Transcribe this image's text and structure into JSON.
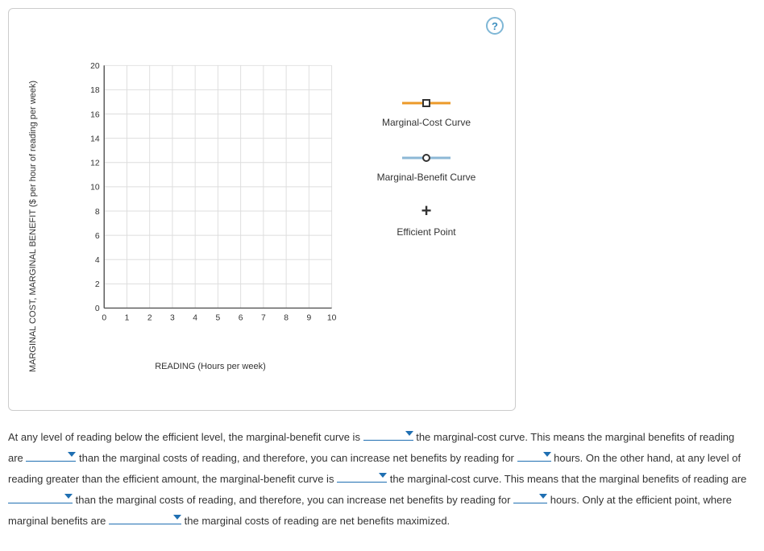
{
  "help_label": "?",
  "chart_data": {
    "type": "scatter",
    "title": "",
    "xlabel": "READING (Hours per week)",
    "ylabel": "MARGINAL COST, MARGINAL BENEFIT ($ per hour of reading per week)",
    "xlim": [
      0,
      10
    ],
    "ylim": [
      0,
      20
    ],
    "xticks": [
      0,
      1,
      2,
      3,
      4,
      5,
      6,
      7,
      8,
      9,
      10
    ],
    "yticks": [
      0,
      2,
      4,
      6,
      8,
      10,
      12,
      14,
      16,
      18,
      20
    ],
    "series": [],
    "legend": [
      {
        "name": "Marginal-Cost Curve",
        "style": "orange-square"
      },
      {
        "name": "Marginal-Benefit Curve",
        "style": "blue-circle"
      },
      {
        "name": "Efficient Point",
        "style": "black-plus"
      }
    ]
  },
  "paragraph": {
    "s1": "At any level of reading below the efficient level, the marginal-benefit curve is",
    "s2": "the marginal-cost curve. This means the marginal benefits of reading are",
    "s3": "than the marginal costs of reading, and therefore, you can increase net benefits by reading for",
    "s4": "hours. On the other hand, at any level of reading greater than the efficient amount, the marginal-benefit curve is",
    "s5": "the marginal-cost curve. This means that the marginal benefits of reading are",
    "s6": "than the marginal costs of reading, and therefore, you can increase net benefits by reading for",
    "s7": "hours. Only at the efficient point, where marginal benefits are",
    "s8": "the marginal costs of reading are net benefits maximized.",
    "blanks": {
      "b1": "",
      "b2": "",
      "b3": "",
      "b4": "",
      "b5": "",
      "b6": "",
      "b7": ""
    }
  }
}
